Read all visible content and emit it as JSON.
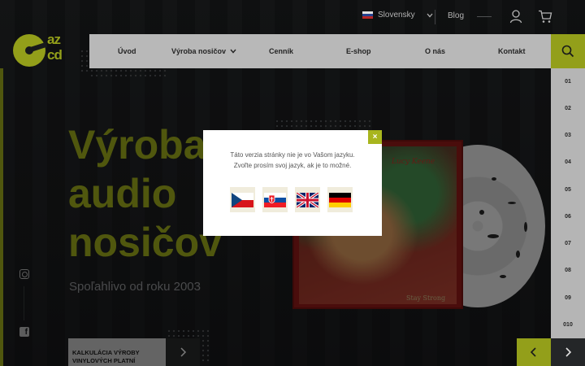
{
  "topbar": {
    "language_label": "Slovensky",
    "blog_label": "Blog"
  },
  "logo": {
    "line1": "az",
    "line2": "cd"
  },
  "nav": {
    "items": [
      {
        "label": "Úvod"
      },
      {
        "label": "Výroba nosičov"
      },
      {
        "label": "Cenník"
      },
      {
        "label": "E-shop"
      },
      {
        "label": "O nás"
      },
      {
        "label": "Kontakt"
      }
    ]
  },
  "rail": {
    "numbers": [
      "01",
      "02",
      "03",
      "04",
      "05",
      "06",
      "07",
      "08",
      "09",
      "010"
    ]
  },
  "hero": {
    "title_line1": "Výroba",
    "title_line2": "audio",
    "title_line3": "nosičov",
    "subtitle": "Spoľahlivo od roku 2003"
  },
  "calc": {
    "label": "KALKULÁCIA VÝROBY VINYLOVÝCH PLATNÍ"
  },
  "album": {
    "artist": "Lucy Keene",
    "title": "Stay Strong"
  },
  "modal": {
    "message_line1": "Táto verzia stránky nie je vo Vašom jazyku.",
    "message_line2": "Zvoľte prosím svoj jazyk, ak je to možné.",
    "close_label": "×",
    "flags": [
      "czech-flag-icon",
      "slovak-flag-icon",
      "uk-flag-icon",
      "german-flag-icon"
    ]
  },
  "colors": {
    "accent": "#a8b51e",
    "nav_bg": "#d2d2d2",
    "page_bg": "#1b1d1f"
  }
}
